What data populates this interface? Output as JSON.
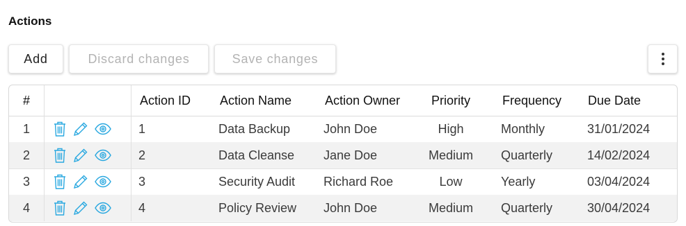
{
  "section_title": "Actions",
  "toolbar": {
    "add_label": "Add",
    "discard_label": "Discard changes",
    "save_label": "Save changes"
  },
  "table": {
    "headers": {
      "index": "#",
      "action_id": "Action ID",
      "action_name": "Action Name",
      "action_owner": "Action Owner",
      "priority": "Priority",
      "frequency": "Frequency",
      "due_date": "Due Date"
    },
    "rows": [
      {
        "index": "1",
        "action_id": "1",
        "action_name": "Data Backup",
        "action_owner": "John Doe",
        "priority": "High",
        "frequency": "Monthly",
        "due_date": "31/01/2024"
      },
      {
        "index": "2",
        "action_id": "2",
        "action_name": "Data Cleanse",
        "action_owner": "Jane Doe",
        "priority": "Medium",
        "frequency": "Quarterly",
        "due_date": "14/02/2024"
      },
      {
        "index": "3",
        "action_id": "3",
        "action_name": "Security Audit",
        "action_owner": "Richard Roe",
        "priority": "Low",
        "frequency": "Yearly",
        "due_date": "03/04/2024"
      },
      {
        "index": "4",
        "action_id": "4",
        "action_name": "Policy Review",
        "action_owner": "John Doe",
        "priority": "Medium",
        "frequency": "Quarterly",
        "due_date": "30/04/2024"
      }
    ]
  },
  "icons": {
    "row_actions": [
      "trash-icon",
      "pencil-icon",
      "eye-icon"
    ],
    "more": "kebab-menu-icon"
  },
  "colors": {
    "icon_accent": "#29a8e0",
    "alt_row": "#f2f2f2",
    "disabled_text": "#b3b3b3"
  }
}
